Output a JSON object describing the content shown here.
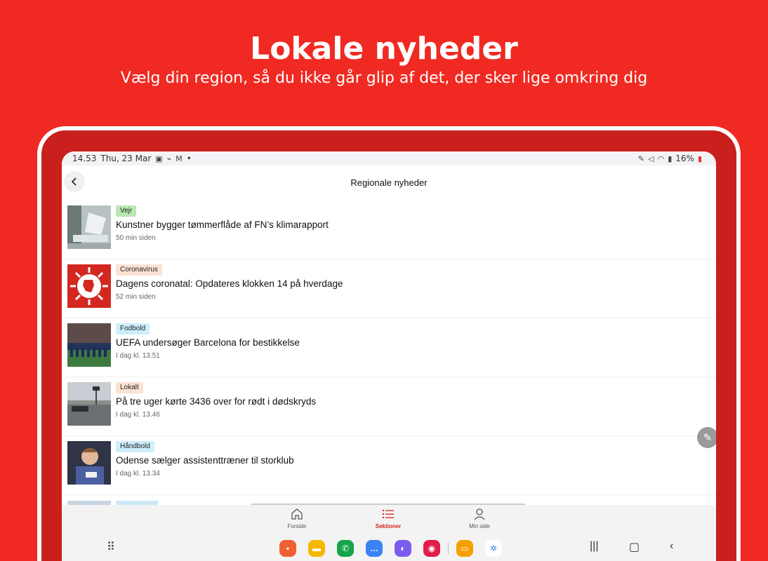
{
  "promo": {
    "title": "Lokale nyheder",
    "subtitle": "Vælg din region, så du ikke går glip af det, der sker lige omkring dig"
  },
  "statusbar": {
    "time": "14.53",
    "date": "Thu, 23 Mar",
    "dot": "•",
    "battery": "16%"
  },
  "appbar": {
    "back_icon": "chevron-left-icon",
    "title": "Regionale nyheder"
  },
  "articles": [
    {
      "tag": "Vejr",
      "tag_color": "#b9e8b2",
      "headline": "Kunstner bygger tømmerflåde af FN’s klimarapport",
      "time": "50 min siden"
    },
    {
      "tag": "Coronavirus",
      "tag_color": "#fde1d3",
      "headline": "Dagens coronatal: Opdateres klokken 14 på hverdage",
      "time": "52 min siden"
    },
    {
      "tag": "Fodbold",
      "tag_color": "#cdeefb",
      "headline": "UEFA undersøger Barcelona for bestikkelse",
      "time": "I dag kl. 13.51"
    },
    {
      "tag": "Lokalt",
      "tag_color": "#fde1d3",
      "headline": "På tre uger kørte 3436 over for rødt i dødskryds",
      "time": "I dag kl. 13.46"
    },
    {
      "tag": "Håndbold",
      "tag_color": "#cdeefb",
      "headline": "Odense sælger assistenttræner til storklub",
      "time": "I dag kl. 13.34"
    }
  ],
  "bottom_nav": [
    {
      "label": "Forside",
      "icon": "home-icon",
      "active": false
    },
    {
      "label": "Sektioner",
      "icon": "list-icon",
      "active": true
    },
    {
      "label": "Min side",
      "icon": "user-icon",
      "active": false
    }
  ],
  "colors": {
    "brand_red": "#f02a22",
    "active_red": "#d4201a"
  }
}
